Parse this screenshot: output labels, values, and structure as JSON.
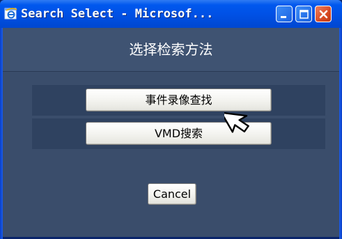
{
  "window": {
    "title": "Search Select - Microsof...",
    "title_icon": "ie-icon",
    "controls": {
      "minimize": "minimize-icon",
      "maximize": "maximize-icon",
      "close": "close-icon"
    }
  },
  "dialog": {
    "heading": "选择检索方法",
    "options": [
      {
        "label": "事件录像查找"
      },
      {
        "label": "VMD搜索"
      }
    ],
    "cancel_label": "Cancel"
  },
  "colors": {
    "titlebar": "#0058ee",
    "client_bg": "#3a4d6b",
    "header_bg": "#3f5372",
    "row_bg": "#2f4260",
    "close_button": "#d84a22"
  },
  "cursor": "arrow-cursor-icon"
}
